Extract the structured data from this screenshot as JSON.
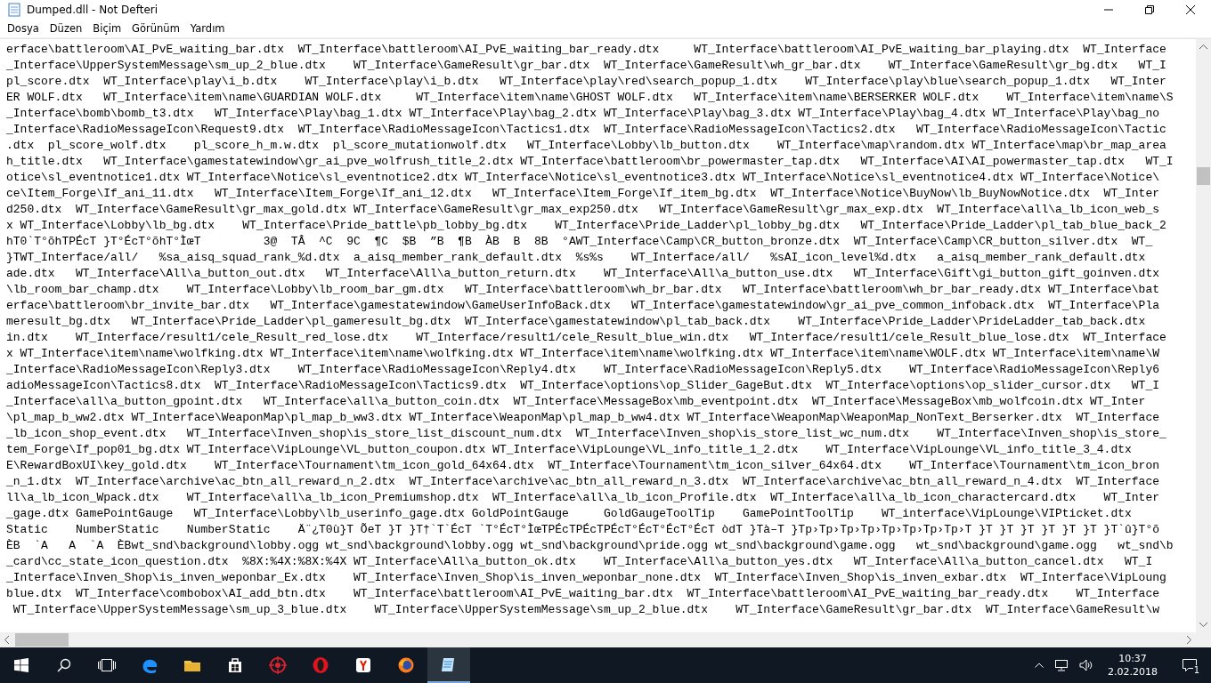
{
  "window": {
    "title": "Dumped.dll - Not Defteri"
  },
  "menu": [
    {
      "label": "Dosya"
    },
    {
      "label": "Düzen"
    },
    {
      "label": "Biçim"
    },
    {
      "label": "Görünüm"
    },
    {
      "label": "Yardım"
    }
  ],
  "lines": [
    "erface\\battleroom\\AI_PvE_waiting_bar.dtx  WT_Interface\\battleroom\\AI_PvE_waiting_bar_ready.dtx     WT_Interface\\battleroom\\AI_PvE_waiting_bar_playing.dtx  WT_Interface",
    "_Interface\\UpperSystemMessage\\sm_up_2_blue.dtx    WT_Interface\\GameResult\\gr_bar.dtx  WT_Interface\\GameResult\\wh_gr_bar.dtx    WT_Interface\\GameResult\\gr_bg.dtx   WT_I",
    "pl_score.dtx  WT_Interface\\play\\i_b.dtx    WT_Interface\\play\\i_b.dtx   WT_Interface\\play\\red\\search_popup_1.dtx    WT_Interface\\play\\blue\\search_popup_1.dtx   WT_Inter",
    "ER WOLF.dtx   WT_Interface\\item\\name\\GUARDIAN WOLF.dtx     WT_Interface\\item\\name\\GHOST WOLF.dtx   WT_Interface\\item\\name\\BERSERKER WOLF.dtx    WT_Interface\\item\\name\\S",
    "_Interface\\bomb\\bomb_t3.dtx   WT_Interface\\Play\\bag_1.dtx WT_Interface\\Play\\bag_2.dtx WT_Interface\\Play\\bag_3.dtx WT_Interface\\Play\\bag_4.dtx WT_Interface\\Play\\bag_no",
    "_Interface\\RadioMessageIcon\\Request9.dtx  WT_Interface\\RadioMessageIcon\\Tactics1.dtx  WT_Interface\\RadioMessageIcon\\Tactics2.dtx   WT_Interface\\RadioMessageIcon\\Tactic",
    ".dtx  pl_score_wolf.dtx    pl_score_h_m.w.dtx  pl_score_mutationwolf.dtx   WT_Interface\\Lobby\\lb_button.dtx    WT_Interface\\map\\random.dtx WT_Interface\\map\\br_map_area",
    "h_title.dtx   WT_Interface\\gamestatewindow\\gr_ai_pve_wolfrush_title_2.dtx WT_Interface\\battleroom\\br_powermaster_tap.dtx   WT_Interface\\AI\\AI_powermaster_tap.dtx   WT_I",
    "otice\\sl_eventnotice1.dtx WT_Interface\\Notice\\sl_eventnotice2.dtx WT_Interface\\Notice\\sl_eventnotice3.dtx WT_Interface\\Notice\\sl_eventnotice4.dtx WT_Interface\\Notice\\",
    "ce\\Item_Forge\\If_ani_11.dtx   WT_Interface\\Item_Forge\\If_ani_12.dtx   WT_Interface\\Item_Forge\\If_item_bg.dtx  WT_Interface\\Notice\\BuyNow\\lb_BuyNowNotice.dtx  WT_Inter",
    "d250.dtx  WT_Interface\\GameResult\\gr_max_gold.dtx WT_Interface\\GameResult\\gr_max_exp250.dtx   WT_Interface\\GameResult\\gr_max_exp.dtx  WT_Interface\\all\\a_lb_icon_web_s",
    "x WT_Interface\\Lobby\\lb_bg.dtx    WT_Interface\\Pride_battle\\pb_lobby_bg.dtx    WT_Interface\\Pride_Ladder\\pl_lobby_bg.dtx   WT_Interface\\Pride_Ladder\\pl_tab_blue_back_2",
    "hT0`T°õhTPÉcT }T°ÉcT°õhT°ÌœT         3@  TÂ  ^C  9C  ¶C  $B  ”B  ¶B  ÀB  B  8B  °AWT_Interface\\Camp\\CR_button_bronze.dtx  WT_Interface\\Camp\\CR_button_silver.dtx  WT_",
    "}TWT_Interface/all/   %sa_aisq_squad_rank_%d.dtx  a_aisq_member_rank_default.dtx  %s%s    WT_Interface/all/   %sAI_icon_level%d.dtx   a_aisq_member_rank_default.dtx",
    "ade.dtx   WT_Interface\\All\\a_button_out.dtx   WT_Interface\\All\\a_button_return.dtx    WT_Interface\\All\\a_button_use.dtx   WT_Interface\\Gift\\gi_button_gift_goinven.dtx",
    "\\lb_room_bar_champ.dtx    WT_Interface\\Lobby\\lb_room_bar_gm.dtx   WT_Interface\\battleroom\\wh_br_bar.dtx   WT_Interface\\battleroom\\wh_br_bar_ready.dtx WT_Interface\\bat",
    "erface\\battleroom\\br_invite_bar.dtx   WT_Interface\\gamestatewindow\\GameUserInfoBack.dtx   WT_Interface\\gamestatewindow\\gr_ai_pve_common_infoback.dtx  WT_Interface\\Pla",
    "meresult_bg.dtx   WT_Interface\\Pride_Ladder\\pl_gameresult_bg.dtx  WT_Interface\\gamestatewindow\\pl_tab_back.dtx    WT_Interface\\Pride_Ladder\\PrideLadder_tab_back.dtx",
    "in.dtx    WT_Interface/result1/cele_Result_red_lose.dtx    WT_Interface/result1/cele_Result_blue_win.dtx   WT_Interface/result1/cele_Result_blue_lose.dtx  WT_Interface",
    "x WT_Interface\\item\\name\\wolfking.dtx WT_Interface\\item\\name\\wolfking.dtx WT_Interface\\item\\name\\wolfking.dtx WT_Interface\\item\\name\\WOLF.dtx WT_Interface\\item\\name\\W",
    "_Interface\\RadioMessageIcon\\Reply3.dtx    WT_Interface\\RadioMessageIcon\\Reply4.dtx    WT_Interface\\RadioMessageIcon\\Reply5.dtx    WT_Interface\\RadioMessageIcon\\Reply6",
    "adioMessageIcon\\Tactics8.dtx  WT_Interface\\RadioMessageIcon\\Tactics9.dtx  WT_Interface\\options\\op_Slider_GageBut.dtx  WT_Interface\\options\\op_slider_cursor.dtx   WT_I",
    "_Interface\\all\\a_button_gpoint.dtx   WT_Interface\\all\\a_button_coin.dtx  WT_Interface\\MessageBox\\mb_eventpoint.dtx  WT_Interface\\MessageBox\\mb_wolfcoin.dtx WT_Inter",
    "\\pl_map_b_ww2.dtx WT_Interface\\WeaponMap\\pl_map_b_ww3.dtx WT_Interface\\WeaponMap\\pl_map_b_ww4.dtx WT_Interface\\WeaponMap\\WeaponMap_NonText_Berserker.dtx  WT_Interface",
    "_lb_icon_shop_event.dtx   WT_Interface\\Inven_shop\\is_store_list_discount_num.dtx  WT_Interface\\Inven_shop\\is_store_list_wc_num.dtx    WT_Interface\\Inven_shop\\is_store_",
    "tem_Forge\\If_pop01_bg.dtx WT_Interface\\VipLounge\\VL_button_coupon.dtx WT_Interface\\VipLounge\\VL_info_title_1_2.dtx    WT_Interface\\VipLounge\\VL_info_title_3_4.dtx",
    "E\\RewardBoxUI\\key_gold.dtx    WT_Interface\\Tournament\\tm_icon_gold_64x64.dtx  WT_Interface\\Tournament\\tm_icon_silver_64x64.dtx    WT_Interface\\Tournament\\tm_icon_bron",
    "_n_1.dtx  WT_Interface\\archive\\ac_btn_all_reward_n_2.dtx  WT_Interface\\archive\\ac_btn_all_reward_n_3.dtx  WT_Interface\\archive\\ac_btn_all_reward_n_4.dtx  WT_Interface",
    "ll\\a_lb_icon_Wpack.dtx    WT_Interface\\all\\a_lb_icon_Premiumshop.dtx  WT_Interface\\all\\a_lb_icon_Profile.dtx  WT_Interface\\all\\a_lb_icon_charactercard.dtx    WT_Inter",
    "_gage.dtx GamePointGauge   WT_Interface\\Lobby\\lb_userinfo_gage.dtx GoldPointGauge     GoldGaugeToolTip    GamePointToolTip    WT_interface\\VipLounge\\VIPticket.dtx",
    "Static    NumberStatic    NumberStatic    Ä¨¿T0ù}T ÕeT }T }T†`T`ÉcT `T°ÉcT°ÌœTPÉcTPÉcTPÉcT°ÉcT°ÉcT°ÉcT òdT }Tà–T }Tp›Tp›Tp›Tp›Tp›Tp›Tp›Tp›T }T }T }T }T }T }T }T`û}T°õ",
    "ÈB  `A   A  `A  ÈBwt_snd\\background\\lobby.ogg wt_snd\\background\\lobby.ogg wt_snd\\background\\pride.ogg wt_snd\\background\\game.ogg   wt_snd\\background\\game.ogg   wt_snd\\b",
    "_card\\cc_state_icon_question.dtx  %8X:%4X:%8X:%4X WT_Interface\\All\\a_button_ok.dtx    WT_Interface\\All\\a_button_yes.dtx   WT_Interface\\All\\a_button_cancel.dtx   WT_I",
    "_Interface\\Inven_Shop\\is_inven_weponbar_Ex.dtx    WT_Interface\\Inven_Shop\\is_inven_weponbar_none.dtx  WT_Interface\\Inven_Shop\\is_inven_exbar.dtx  WT_Interface\\VipLoung",
    "blue.dtx  WT_Interface\\combobox\\AI_add_btn.dtx    WT_Interface\\battleroom\\AI_PvE_waiting_bar.dtx  WT_Interface\\battleroom\\AI_PvE_waiting_bar_ready.dtx    WT_Interface",
    " WT_Interface\\UpperSystemMessage\\sm_up_3_blue.dtx    WT_Interface\\UpperSystemMessage\\sm_up_2_blue.dtx    WT_Interface\\GameResult\\gr_bar.dtx  WT_Interface\\GameResult\\w"
  ],
  "taskbar": {
    "apps": [
      {
        "kind": "edge",
        "active": false
      },
      {
        "kind": "folder",
        "active": false
      },
      {
        "kind": "store",
        "active": false
      },
      {
        "kind": "game",
        "active": false
      },
      {
        "kind": "opera",
        "active": false
      },
      {
        "kind": "yandex",
        "active": false
      },
      {
        "kind": "firefox",
        "active": false
      },
      {
        "kind": "notepad",
        "active": true
      }
    ],
    "time": "10:37",
    "date": "2.02.2018",
    "notifications": "1"
  }
}
